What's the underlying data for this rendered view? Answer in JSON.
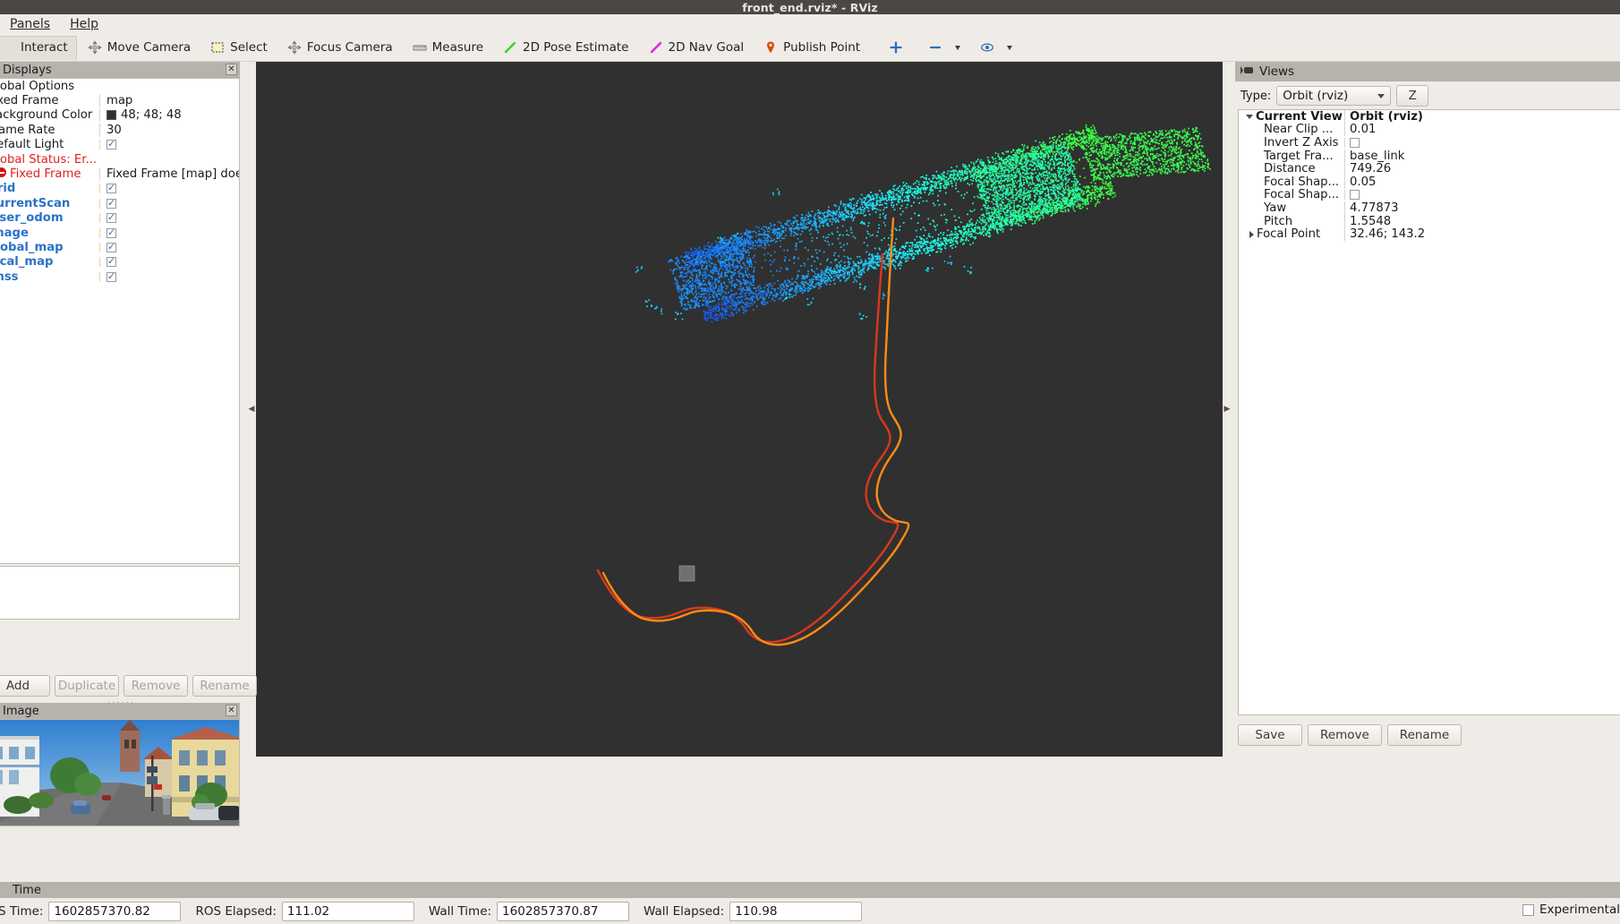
{
  "window": {
    "title": "front_end.rviz* - RViz"
  },
  "menubar": {
    "items": [
      {
        "label": "Panels"
      },
      {
        "label": "Help"
      }
    ]
  },
  "toolbar": {
    "items": [
      {
        "label": "Interact",
        "icon": "interact-icon",
        "active": true
      },
      {
        "label": "Move Camera",
        "icon": "move-camera-icon",
        "active": false
      },
      {
        "label": "Select",
        "icon": "select-icon",
        "active": false
      },
      {
        "label": "Focus Camera",
        "icon": "focus-camera-icon",
        "active": false
      },
      {
        "label": "Measure",
        "icon": "measure-ruler-icon",
        "active": false
      },
      {
        "label": "2D Pose Estimate",
        "icon": "pose-estimate-arrow-icon",
        "active": false
      },
      {
        "label": "2D Nav Goal",
        "icon": "nav-goal-arrow-icon",
        "active": false
      },
      {
        "label": "Publish Point",
        "icon": "publish-point-pin-icon",
        "active": false
      },
      {
        "label": "",
        "icon": "add-tool-plus-icon",
        "active": false
      },
      {
        "label": "",
        "icon": "remove-tool-minus-icon",
        "active": false
      },
      {
        "label": "",
        "icon": "eye-visibility-icon",
        "active": false
      }
    ]
  },
  "displays": {
    "panel_title": "Displays",
    "close_label": "✕",
    "rows": [
      {
        "label": "Global Options",
        "value": "",
        "kind": "group",
        "style": "plain"
      },
      {
        "label": "Fixed Frame",
        "value": "map",
        "kind": "text",
        "style": "plain"
      },
      {
        "label": "Background Color",
        "value": "48; 48; 48",
        "kind": "color",
        "style": "plain",
        "color": "#303030"
      },
      {
        "label": "Frame Rate",
        "value": "30",
        "kind": "text",
        "style": "plain"
      },
      {
        "label": "Default Light",
        "value": "",
        "kind": "checkbox",
        "style": "plain",
        "checked": true
      },
      {
        "label": "Global Status: Er...",
        "value": "",
        "kind": "status",
        "style": "error"
      },
      {
        "label": "Fixed Frame",
        "value": "Fixed Frame [map] doe...",
        "kind": "errorrow",
        "style": "error"
      },
      {
        "label": "Grid",
        "value": "",
        "kind": "checkbox",
        "style": "blue",
        "checked": true
      },
      {
        "label": "CurrentScan",
        "value": "",
        "kind": "checkbox",
        "style": "blue",
        "checked": true
      },
      {
        "label": "laser_odom",
        "value": "",
        "kind": "checkbox",
        "style": "blue",
        "checked": true
      },
      {
        "label": "Image",
        "value": "",
        "kind": "checkbox",
        "style": "blue",
        "checked": true
      },
      {
        "label": "global_map",
        "value": "",
        "kind": "checkbox",
        "style": "blue",
        "checked": true
      },
      {
        "label": "local_map",
        "value": "",
        "kind": "checkbox",
        "style": "blue",
        "checked": true
      },
      {
        "label": "gnss",
        "value": "",
        "kind": "checkbox",
        "style": "blue",
        "checked": true
      }
    ],
    "buttons": [
      {
        "label": "Add",
        "disabled": false
      },
      {
        "label": "Duplicate",
        "disabled": true
      },
      {
        "label": "Remove",
        "disabled": true
      },
      {
        "label": "Rename",
        "disabled": true
      }
    ]
  },
  "image_panel": {
    "title": "Image"
  },
  "views": {
    "panel_title": "Views",
    "type_label": "Type:",
    "type_value": "Orbit (rviz)",
    "rows": [
      {
        "key": "Current View",
        "value": "Orbit (rviz)",
        "kind": "group",
        "bold": true
      },
      {
        "key": "Near Clip ...",
        "value": "0.01",
        "kind": "text"
      },
      {
        "key": "Invert Z Axis",
        "value": "",
        "kind": "checkbox",
        "checked": false
      },
      {
        "key": "Target Fra...",
        "value": "base_link",
        "kind": "text"
      },
      {
        "key": "Distance",
        "value": "749.26",
        "kind": "text"
      },
      {
        "key": "Focal Shap...",
        "value": "0.05",
        "kind": "text"
      },
      {
        "key": "Focal Shap...",
        "value": "",
        "kind": "checkbox",
        "checked": false
      },
      {
        "key": "Yaw",
        "value": "4.77873",
        "kind": "text"
      },
      {
        "key": "Pitch",
        "value": "1.5548",
        "kind": "text"
      },
      {
        "key": "Focal Point",
        "value": "32.46; 143.2",
        "kind": "subgroup"
      }
    ],
    "buttons": [
      {
        "label": "Save"
      },
      {
        "label": "Remove"
      },
      {
        "label": "Rename"
      }
    ]
  },
  "statusbar": {
    "title": "Time",
    "fields": [
      {
        "label": "ROS Time:",
        "value": "1602857370.82"
      },
      {
        "label": "ROS Elapsed:",
        "value": "111.02"
      },
      {
        "label": "Wall Time:",
        "value": "1602857370.87"
      },
      {
        "label": "Wall Elapsed:",
        "value": "110.98"
      }
    ],
    "experimental_label": "Experimental",
    "experimental_checked": false
  },
  "viewport": {
    "background_color": "#303030",
    "pointcloud_note": "colored laser point cloud map (blue-cyan-green gradient)",
    "trajectory_note": "red and orange odometry trajectory paths"
  }
}
